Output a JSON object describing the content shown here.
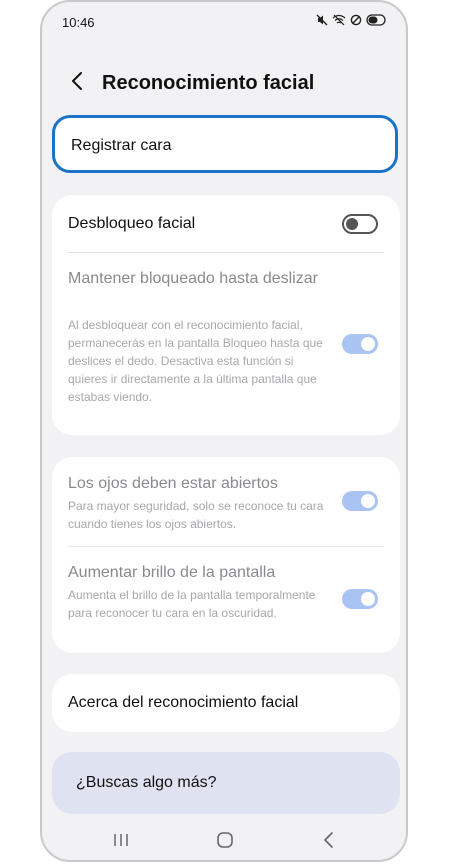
{
  "status": {
    "time": "10:46"
  },
  "header": {
    "title": "Reconocimiento facial"
  },
  "register": {
    "label": "Registrar cara"
  },
  "unlock": {
    "face_unlock_label": "Desbloqueo facial",
    "face_unlock_on": false,
    "stay_locked_title": "Mantener bloqueado hasta deslizar",
    "stay_locked_desc": "Al desbloquear con el reconocimiento facial, permanecerás en la pantalla Bloqueo hasta que deslices el dedo. Desactiva esta función si quieres ir directamente a la última pantalla que estabas viendo.",
    "stay_locked_on": true
  },
  "security": {
    "eyes_open_title": "Los ojos deben estar abiertos",
    "eyes_open_desc": "Para mayor seguridad, solo se reconoce tu cara cuando tienes los ojos abiertos.",
    "eyes_open_on": true,
    "brightness_title": "Aumentar brillo de la pantalla",
    "brightness_desc": "Aumenta el brillo de la pantalla temporalmente para reconocer tu cara en la oscuridad.",
    "brightness_on": true
  },
  "about": {
    "label": "Acerca del reconocimiento facial"
  },
  "search": {
    "label": "¿Buscas algo más?"
  },
  "colors": {
    "accent": "#1a73c9",
    "toggle_on": "#a9c4f3",
    "search_bg": "#dfe3f1"
  },
  "icons": [
    "mute-icon",
    "wifi-icon",
    "no-sim-icon",
    "battery-icon",
    "back-arrow-icon",
    "recents-icon",
    "home-icon",
    "nav-back-icon"
  ]
}
